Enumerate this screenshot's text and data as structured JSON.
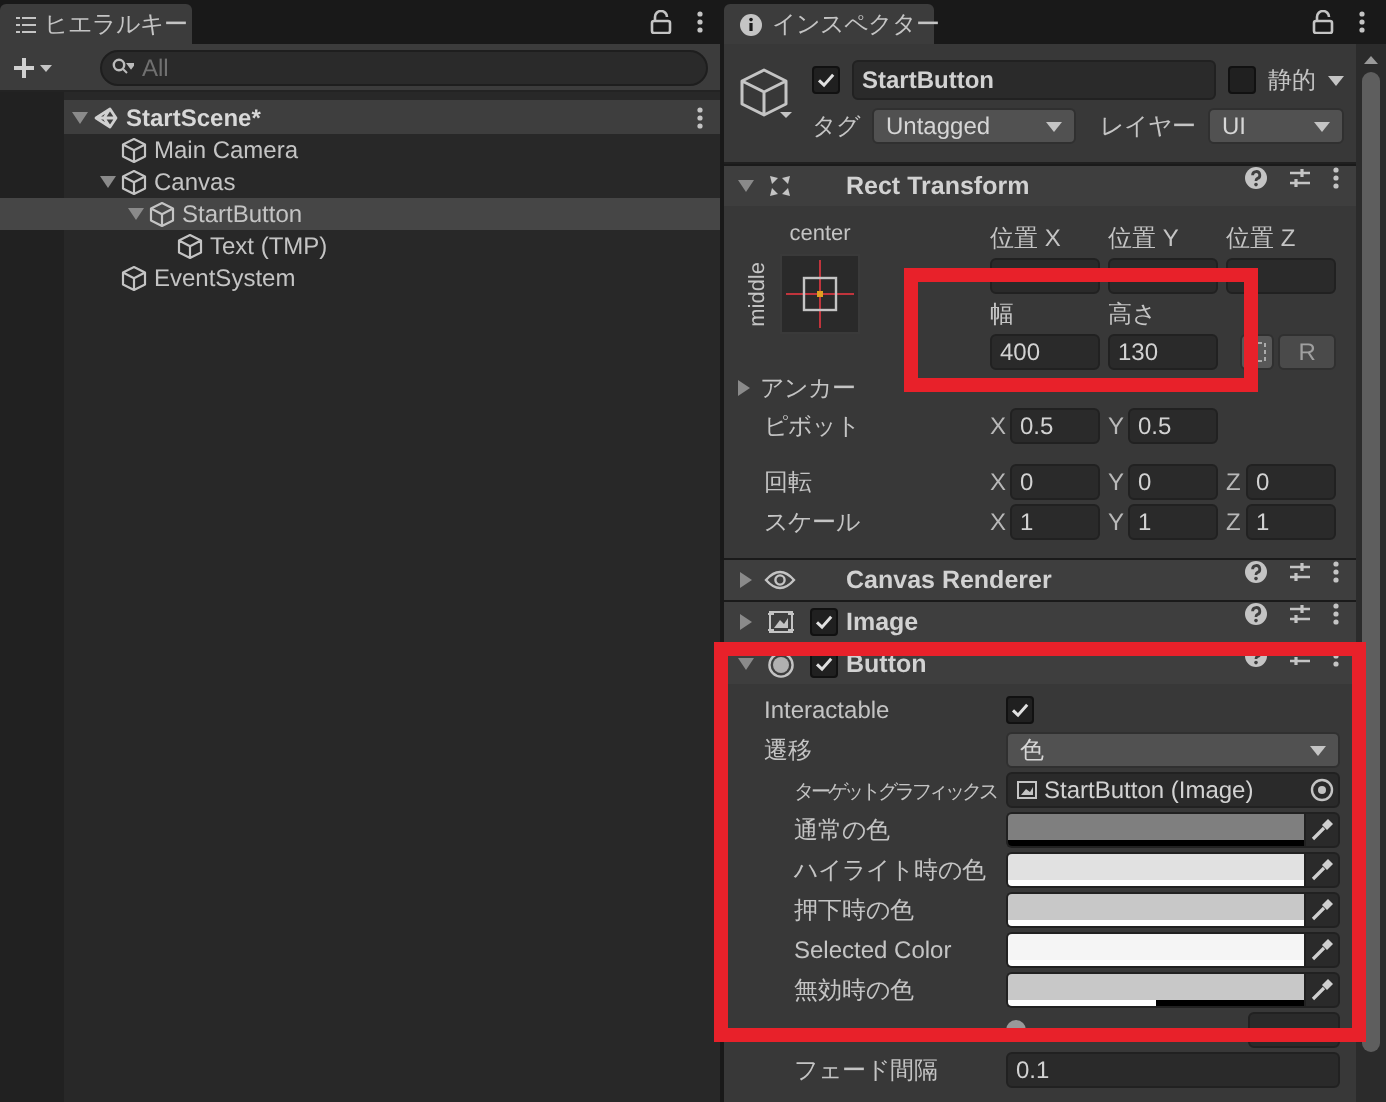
{
  "hierarchy": {
    "title": "ヒエラルキー",
    "search": {
      "placeholder": "All"
    },
    "tree": [
      {
        "name": "StartScene*",
        "kind": "scene",
        "expanded": true,
        "selected": false,
        "children": [
          {
            "name": "Main Camera",
            "kind": "object",
            "selected": false
          },
          {
            "name": "Canvas",
            "kind": "object",
            "expanded": true,
            "selected": false,
            "children": [
              {
                "name": "StartButton",
                "kind": "object",
                "expanded": true,
                "selected": true,
                "children": [
                  {
                    "name": "Text (TMP)",
                    "kind": "object",
                    "selected": false
                  }
                ]
              }
            ]
          },
          {
            "name": "EventSystem",
            "kind": "object",
            "selected": false
          }
        ]
      }
    ]
  },
  "inspector": {
    "title": "インスペクター",
    "object": {
      "active": true,
      "name": "StartButton",
      "static": false,
      "static_label": "静的",
      "tag_label": "タグ",
      "tag": "Untagged",
      "layer_label": "レイヤー",
      "layer": "UI"
    },
    "components": [
      {
        "kind": "rect_transform",
        "title": "Rect Transform",
        "expanded": true,
        "anchor_h": "center",
        "anchor_v": "middle",
        "position_labels": [
          "位置 X",
          "位置 Y",
          "位置 Z"
        ],
        "size_labels": [
          "幅",
          "高さ"
        ],
        "size_values": [
          "400",
          "130"
        ],
        "reset_label": "R",
        "anchors_label": "アンカー",
        "anchors_expanded": false,
        "rows": [
          {
            "label": "ピボット",
            "axes": [
              {
                "axis": "X",
                "value": "0.5"
              },
              {
                "axis": "Y",
                "value": "0.5"
              }
            ]
          },
          {
            "label": "回転",
            "axes": [
              {
                "axis": "X",
                "value": "0"
              },
              {
                "axis": "Y",
                "value": "0"
              },
              {
                "axis": "Z",
                "value": "0"
              }
            ]
          },
          {
            "label": "スケール",
            "axes": [
              {
                "axis": "X",
                "value": "1"
              },
              {
                "axis": "Y",
                "value": "1"
              },
              {
                "axis": "Z",
                "value": "1"
              }
            ]
          }
        ]
      },
      {
        "kind": "canvas_renderer",
        "title": "Canvas Renderer",
        "expanded": false
      },
      {
        "kind": "image",
        "title": "Image",
        "expanded": false,
        "enabled": true
      },
      {
        "kind": "button",
        "title": "Button",
        "expanded": true,
        "enabled": true,
        "properties": [
          {
            "kind": "checkbox",
            "label": "Interactable",
            "checked": true
          },
          {
            "kind": "dropdown",
            "label": "遷移",
            "value": "色",
            "children": [
              {
                "kind": "object",
                "label": "ターゲットグラフィックス",
                "value": "StartButton (Image)"
              },
              {
                "kind": "color",
                "label": "通常の色",
                "color": "#7f7f7f",
                "level": 0
              },
              {
                "kind": "color",
                "label": "ハイライト時の色",
                "color": "#e1e1e1",
                "level": 1
              },
              {
                "kind": "color",
                "label": "押下時の色",
                "color": "#c8c8c8",
                "level": 1
              },
              {
                "kind": "color",
                "label": "Selected Color",
                "color": "#f5f5f5",
                "level": 1
              },
              {
                "kind": "color",
                "label": "無効時の色",
                "color": "#c8c8c8",
                "level": 0.5
              },
              {
                "kind": "slider",
                "level": 0
              },
              {
                "kind": "field",
                "label": "フェード間隔",
                "value": "0.1"
              }
            ]
          }
        ]
      }
    ]
  },
  "annotations": [
    {
      "kind": "highlight",
      "color": "#e8212a"
    },
    {
      "kind": "highlight",
      "color": "#e8212a"
    }
  ]
}
